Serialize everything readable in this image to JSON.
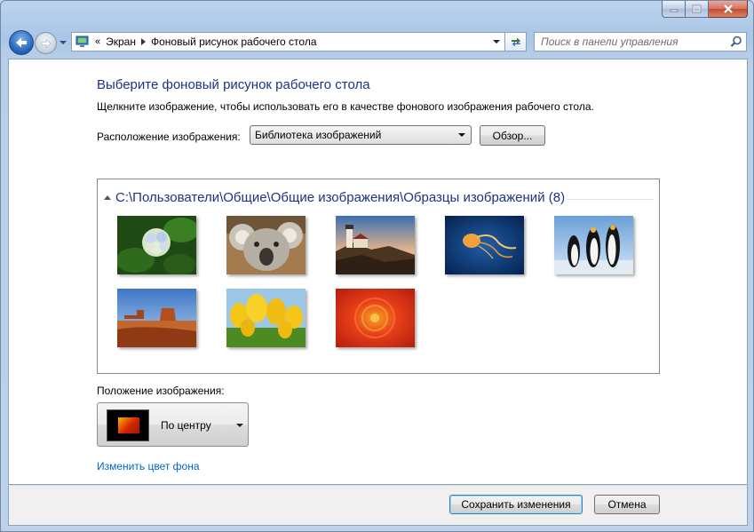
{
  "window": {
    "caption_buttons": [
      "minimize-icon",
      "maximize-icon",
      "close-icon"
    ]
  },
  "nav": {
    "back_icon": "back-arrow-icon",
    "forward_icon": "forward-arrow-icon"
  },
  "address": {
    "overflow": "«",
    "crumbs": [
      "Экран",
      "Фоновый рисунок рабочего стола"
    ]
  },
  "search": {
    "placeholder": "Поиск в панели управления"
  },
  "page": {
    "title": "Выберите фоновый рисунок рабочего стола",
    "description": "Щелкните изображение, чтобы использовать его в качестве фонового изображения рабочего стола.",
    "location_label": "Расположение изображения:",
    "location_value": "Библиотека изображений",
    "browse_label": "Обзор...",
    "group_path": "C:\\Пользователи\\Общие\\Общие изображения\\Образцы изображений (8)",
    "thumbnails": [
      "hydrangea",
      "koala",
      "lighthouse",
      "jellyfish",
      "penguins",
      "desert",
      "tulips",
      "chrysanthemum"
    ],
    "position_label": "Положение изображения:",
    "position_value": "По центру",
    "change_color_link": "Изменить цвет фона"
  },
  "footer": {
    "save_label": "Сохранить изменения",
    "cancel_label": "Отмена"
  }
}
